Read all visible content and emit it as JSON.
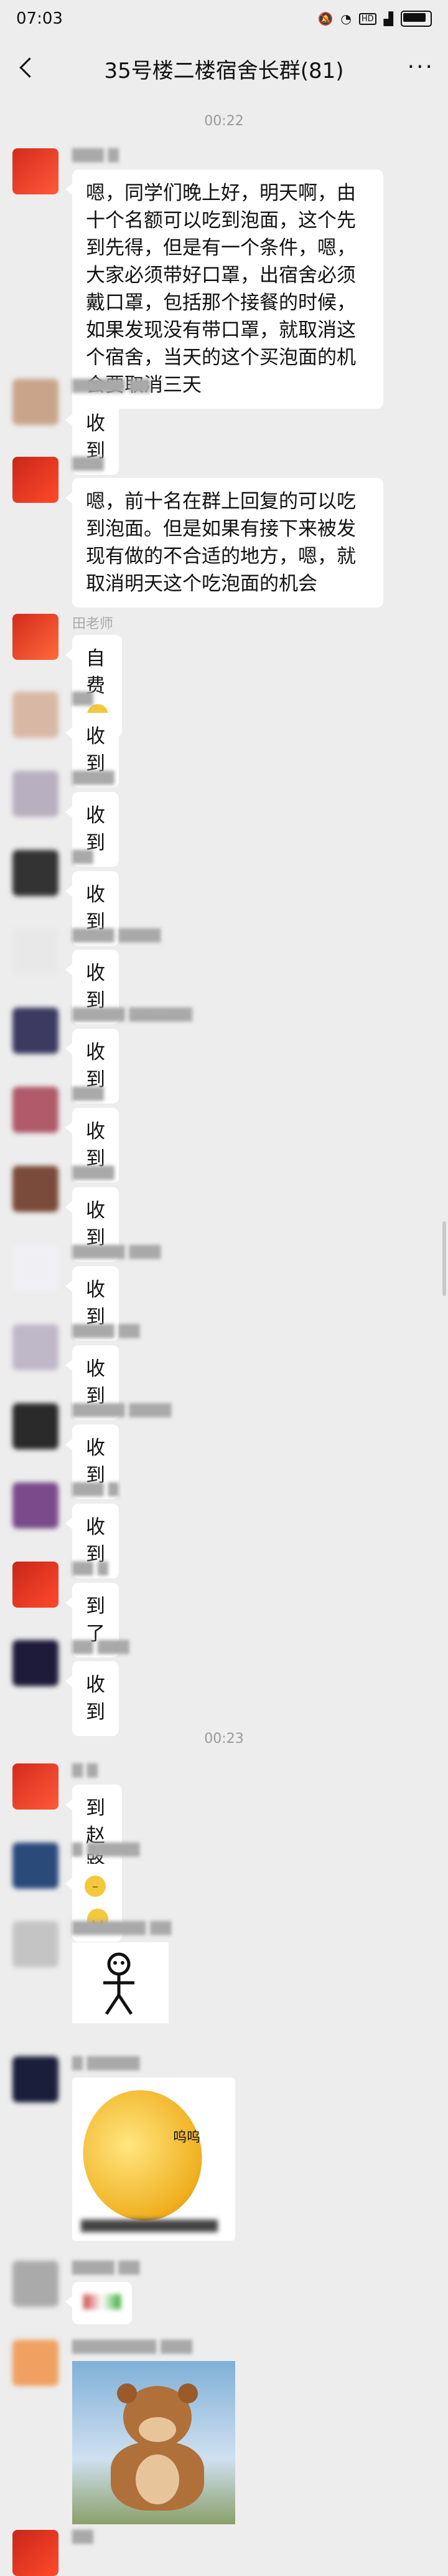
{
  "status": {
    "time": "07:03",
    "signal_icons": [
      "mute-icon",
      "alarm-icon",
      "wifi-icon",
      "hd-icon",
      "signal-icon",
      "battery-icon"
    ]
  },
  "header": {
    "title": "35号楼二楼宿舍长群(81)",
    "back_icon": "back-arrow-icon",
    "more_icon": "more-icon"
  },
  "timestamps": [
    "00:22",
    "00:23"
  ],
  "messages": [
    {
      "text": "嗯，同学们晚上好，明天啊，由十个名额可以吃到泡面，这个先到先得，但是有一个条件，嗯，大家必须带好口罩，出宿舍必须戴口罩，包括那个接餐的时候，如果发现没有带口罩，就取消这个宿舍，当天的这个买泡面的机会要取消三天"
    },
    {
      "text": "收到"
    },
    {
      "text": "嗯，前十名在群上回复的可以吃到泡面。但是如果有接下来被发现有做的不合适的地方，嗯，就取消明天这个吃泡面的机会"
    },
    {
      "nick": "田老师",
      "text": "自费"
    },
    {
      "text": "收到"
    },
    {
      "text": "收到"
    },
    {
      "text": "收到"
    },
    {
      "text": "收到"
    },
    {
      "text": "收到"
    },
    {
      "text": "收到"
    },
    {
      "text": "收到"
    },
    {
      "text": "收到"
    },
    {
      "text": "收到"
    },
    {
      "text": "收到"
    },
    {
      "text": "收到"
    },
    {
      "text": "到了"
    },
    {
      "text": "收到"
    },
    {
      "text": "到赵路远"
    },
    {
      "text": ""
    },
    {
      "text": ""
    },
    {
      "sticker_text": "呜呜"
    },
    {
      "text": ""
    },
    {
      "text": ""
    }
  ],
  "colors": {
    "background": "#ededed",
    "bubble": "#ffffff"
  }
}
